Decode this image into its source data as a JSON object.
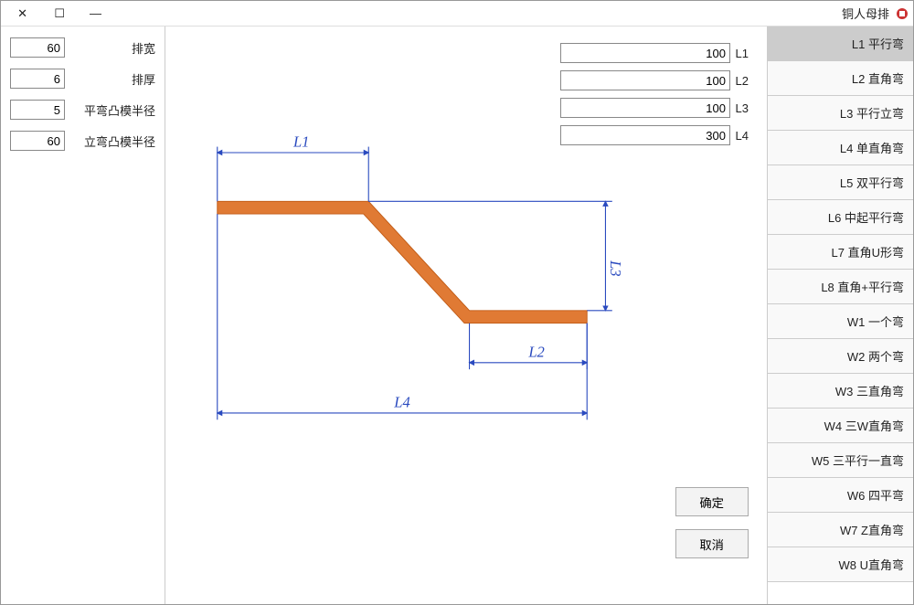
{
  "window": {
    "title": "铜人母排"
  },
  "sidebar": {
    "items": [
      {
        "label": "L1 平行弯"
      },
      {
        "label": "L2 直角弯"
      },
      {
        "label": "L3 平行立弯"
      },
      {
        "label": "L4 单直角弯"
      },
      {
        "label": "L5 双平行弯"
      },
      {
        "label": "L6 中起平行弯"
      },
      {
        "label": "L7 直角U形弯"
      },
      {
        "label": "L8 直角+平行弯"
      },
      {
        "label": "W1 一个弯"
      },
      {
        "label": "W2 两个弯"
      },
      {
        "label": "W3 三直角弯"
      },
      {
        "label": "W4 三W直角弯"
      },
      {
        "label": "W5 三平行一直弯"
      },
      {
        "label": "W6 四平弯"
      },
      {
        "label": "W7 Z直角弯"
      },
      {
        "label": "W8 U直角弯"
      }
    ],
    "selected_index": 0
  },
  "params": {
    "L1": {
      "label": "L1",
      "value": "100"
    },
    "L2": {
      "label": "L2",
      "value": "100"
    },
    "L3": {
      "label": "L3",
      "value": "100"
    },
    "L4": {
      "label": "L4",
      "value": "300"
    }
  },
  "right_panel": {
    "width": {
      "label": "排宽",
      "value": "60"
    },
    "thick": {
      "label": "排厚",
      "value": "6"
    },
    "r_flat": {
      "label": "平弯凸模半径",
      "value": "5"
    },
    "r_vert": {
      "label": "立弯凸模半径",
      "value": "60"
    }
  },
  "dims": {
    "l1": "L1",
    "l2": "L2",
    "l3": "L3",
    "l4": "L4"
  },
  "buttons": {
    "ok": "确定",
    "cancel": "取消"
  },
  "icons": {
    "min": "—",
    "max": "☐",
    "close": "✕"
  }
}
